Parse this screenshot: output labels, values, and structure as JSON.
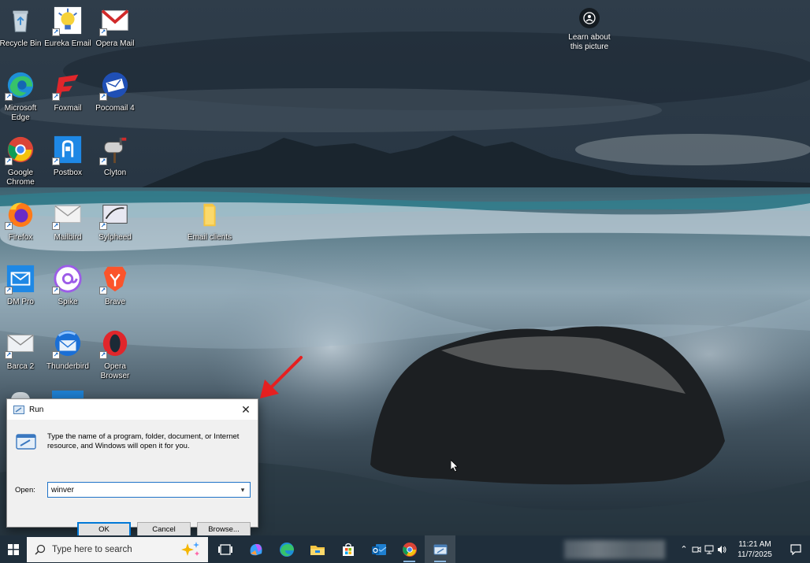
{
  "desktop": {
    "icons": [
      {
        "id": "recycle",
        "label": "Recycle Bin"
      },
      {
        "id": "eureka",
        "label": "Eureka Email"
      },
      {
        "id": "opera-mail",
        "label": "Opera  Mail"
      },
      {
        "id": "edge",
        "label": "Microsoft Edge"
      },
      {
        "id": "foxmail",
        "label": "Foxmail"
      },
      {
        "id": "pocomail",
        "label": "Pocomail 4"
      },
      {
        "id": "chrome",
        "label": "Google Chrome"
      },
      {
        "id": "postbox",
        "label": "Postbox"
      },
      {
        "id": "clyton",
        "label": "Clyton"
      },
      {
        "id": "firefox",
        "label": "Firefox"
      },
      {
        "id": "mailbird",
        "label": "Mailbird"
      },
      {
        "id": "sylpheed",
        "label": "Sylpheed"
      },
      {
        "id": "email-clients",
        "label": "Email clients"
      },
      {
        "id": "dmpro",
        "label": "DM Pro"
      },
      {
        "id": "spike",
        "label": "Spike"
      },
      {
        "id": "brave",
        "label": "Brave"
      },
      {
        "id": "barca",
        "label": "Barca 2"
      },
      {
        "id": "thunderbird",
        "label": "Thunderbird"
      },
      {
        "id": "opera-browser",
        "label": "Opera Browser"
      }
    ],
    "spotlight_label": "Learn about this picture"
  },
  "run_dialog": {
    "title": "Run",
    "close_glyph": "✕",
    "description": "Type the name of a program, folder, document, or Internet resource, and Windows will open it for you.",
    "open_label": "Open:",
    "input_value": "winver",
    "ok_label": "OK",
    "cancel_label": "Cancel",
    "browse_label": "Browse..."
  },
  "taskbar": {
    "search_placeholder": "Type here to search",
    "apps": [
      "task-view-icon",
      "copilot-icon",
      "edge-icon",
      "file-explorer-icon",
      "store-icon",
      "outlook-icon",
      "chrome-icon",
      "run-icon"
    ],
    "clock_time": "11:21 AM",
    "clock_date": "11/7/2025"
  },
  "colors": {
    "accent": "#0078d7",
    "taskbar_bg": "#1f2e3b",
    "annotation_arrow": "#e62020"
  }
}
